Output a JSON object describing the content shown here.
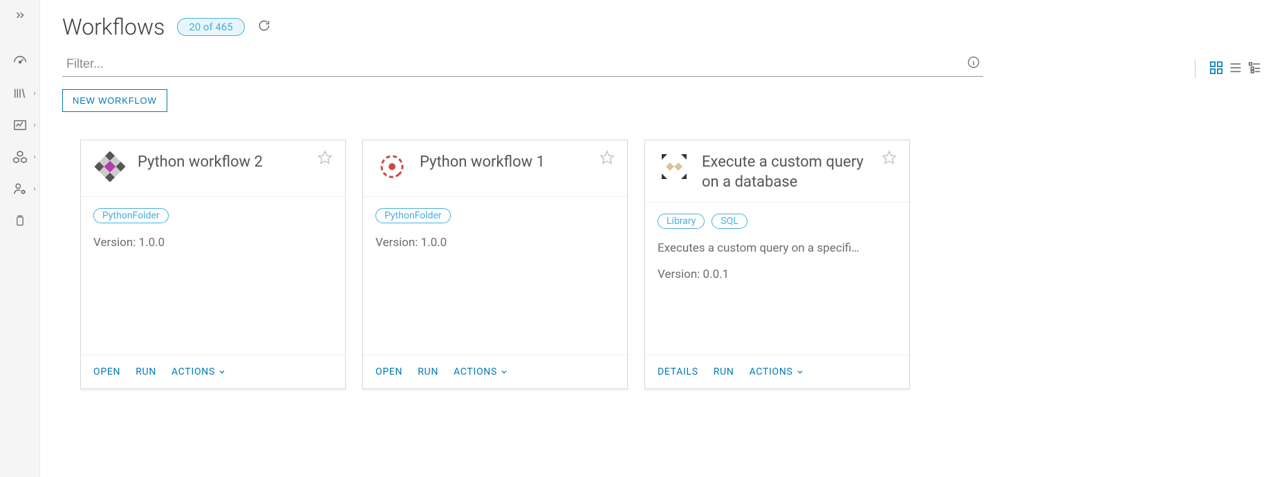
{
  "header": {
    "title": "Workflows",
    "count_label": "20 of 465"
  },
  "filter": {
    "placeholder": "Filter..."
  },
  "buttons": {
    "new_workflow": "NEW WORKFLOW"
  },
  "card_actions": {
    "open": "OPEN",
    "details": "DETAILS",
    "run": "RUN",
    "actions": "ACTIONS"
  },
  "cards": [
    {
      "title": "Python workflow 2",
      "tags": [
        "PythonFolder"
      ],
      "description": "",
      "version_label": "Version: 1.0.0",
      "primary_action": "open",
      "icon": "quilt-purple"
    },
    {
      "title": "Python workflow 1",
      "tags": [
        "PythonFolder"
      ],
      "description": "",
      "version_label": "Version: 1.0.0",
      "primary_action": "open",
      "icon": "quilt-red"
    },
    {
      "title": "Execute a custom query on a database",
      "tags": [
        "Library",
        "SQL"
      ],
      "description": "Executes a custom query on a specifi…",
      "version_label": "Version: 0.0.1",
      "primary_action": "details",
      "icon": "quilt-tan"
    }
  ]
}
